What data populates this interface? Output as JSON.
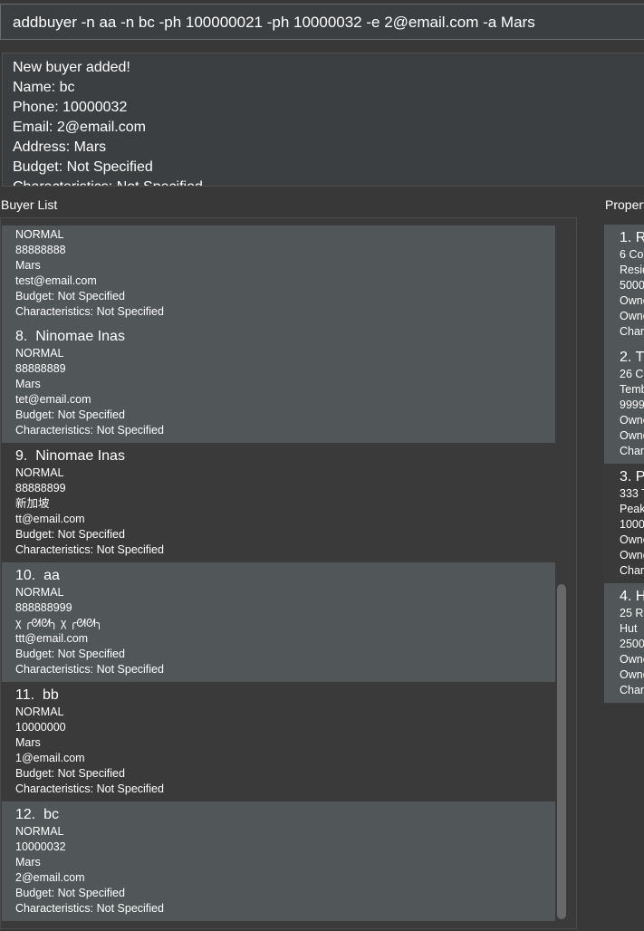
{
  "command_box": {
    "value": "addbuyer -n aa -n bc -ph 100000021 -ph 10000032 -e 2@email.com -a Mars"
  },
  "result_box": {
    "lines": [
      "New buyer added!",
      "Name: bc",
      "Phone: 10000032",
      "Email: 2@email.com",
      "Address: Mars",
      "Budget: Not Specified",
      "Characteristics: Not Specified"
    ]
  },
  "buyer_panel": {
    "title": "Buyer List",
    "partial_card": {
      "lines": [
        "NORMAL",
        "88888888",
        "Mars",
        "test@email.com",
        "Budget: Not Specified",
        "Characteristics: Not Specified"
      ]
    },
    "buyers": [
      {
        "index": "8.",
        "name": "Ninomae Inas",
        "priority": "NORMAL",
        "phone": "88888889",
        "address": "Mars",
        "email": "tet@email.com",
        "budget": "Budget: Not Specified",
        "characteristics": "Characteristics: Not Specified"
      },
      {
        "index": "9.",
        "name": "Ninomae Inas",
        "priority": "NORMAL",
        "phone": "88888899",
        "address": "新加坡",
        "email": "tt@email.com",
        "budget": "Budget: Not Specified",
        "characteristics": "Characteristics: Not Specified"
      },
      {
        "index": "10.",
        "name": "aa",
        "priority": "NORMAL",
        "phone": "888888999",
        "address": "χ ╭ᘛᘛ╮ χ ╭ᘛᘛ╮",
        "email": "ttt@email.com",
        "budget": "Budget: Not Specified",
        "characteristics": "Characteristics: Not Specified"
      },
      {
        "index": "11.",
        "name": "bb",
        "priority": "NORMAL",
        "phone": "10000000",
        "address": "Mars",
        "email": "1@email.com",
        "budget": "Budget: Not Specified",
        "characteristics": "Characteristics: Not Specified"
      },
      {
        "index": "12.",
        "name": "bc",
        "priority": "NORMAL",
        "phone": "10000032",
        "address": "Mars",
        "email": "2@email.com",
        "budget": "Budget: Not Specified",
        "characteristics": "Characteristics: Not Specified"
      }
    ]
  },
  "property_panel": {
    "title": "Propert",
    "properties": [
      {
        "header": "1.  R",
        "lines": [
          "6 Co",
          "Resic",
          "5000",
          "Owne",
          "Owne",
          "Char"
        ]
      },
      {
        "header": "2.  T",
        "lines": [
          "26 C",
          "Temb",
          "9999",
          "Owne",
          "Owne",
          "Char"
        ]
      },
      {
        "header": "3.  P",
        "lines": [
          "333 T",
          "Peak",
          "1000",
          "Owne",
          "Owne",
          "Char"
        ]
      },
      {
        "header": "4.  H",
        "lines": [
          "25 Re",
          "Hut",
          "2500",
          "Owne",
          "Owne",
          "Char"
        ]
      }
    ]
  }
}
